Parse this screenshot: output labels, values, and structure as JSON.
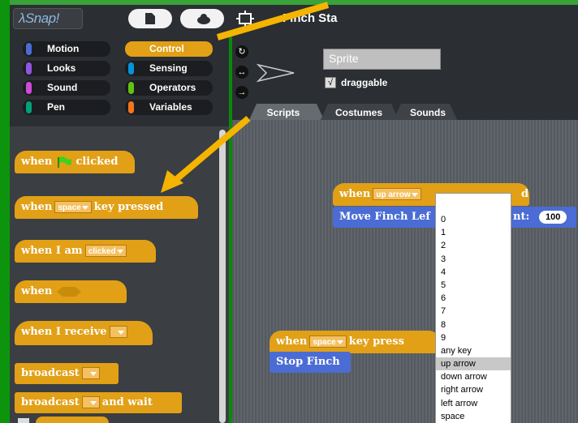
{
  "app": {
    "logo_text": "Snap!",
    "project_title": "Finch Sta"
  },
  "categories": [
    {
      "label": "Motion",
      "color": "#4a6cd4"
    },
    {
      "label": "Control",
      "color": "#e1a016",
      "selected": true
    },
    {
      "label": "Looks",
      "color": "#8f56e3"
    },
    {
      "label": "Sensing",
      "color": "#0494dc"
    },
    {
      "label": "Sound",
      "color": "#cf4ad9"
    },
    {
      "label": "Operators",
      "color": "#62c213"
    },
    {
      "label": "Pen",
      "color": "#00a178"
    },
    {
      "label": "Variables",
      "color": "#f3761d"
    }
  ],
  "palette": {
    "when_flag": {
      "pre": "when",
      "post": "clicked"
    },
    "when_key": {
      "pre": "when",
      "key": "space",
      "post": "key pressed"
    },
    "when_i_am": {
      "pre": "when I am",
      "value": "clicked"
    },
    "when_cond": {
      "pre": "when"
    },
    "when_receive": {
      "pre": "when I receive"
    },
    "broadcast": {
      "pre": "broadcast"
    },
    "broadcast_wait": {
      "pre": "broadcast",
      "post": "and wait"
    }
  },
  "sprite": {
    "name": "Sprite",
    "draggable_label": "draggable",
    "draggable_checked": "√"
  },
  "tabs": {
    "scripts": "Scripts",
    "costumes": "Costumes",
    "sounds": "Sounds"
  },
  "scripts": {
    "script1": {
      "pre": "when",
      "key": "up arrow",
      "post": "d",
      "motor_label": "Move Finch Lef",
      "motor_label_end": "nt:",
      "value": "100"
    },
    "script2": {
      "pre": "when",
      "key": "space",
      "post": "key press",
      "stop_label": "Stop Finch"
    }
  },
  "key_menu": {
    "items": [
      "0",
      "1",
      "2",
      "3",
      "4",
      "5",
      "6",
      "7",
      "8",
      "9",
      "any key",
      "up arrow",
      "down arrow",
      "right arrow",
      "left arrow",
      "space"
    ],
    "highlighted": "up arrow"
  },
  "annotation": {
    "arrow_color": "#f5b400"
  }
}
